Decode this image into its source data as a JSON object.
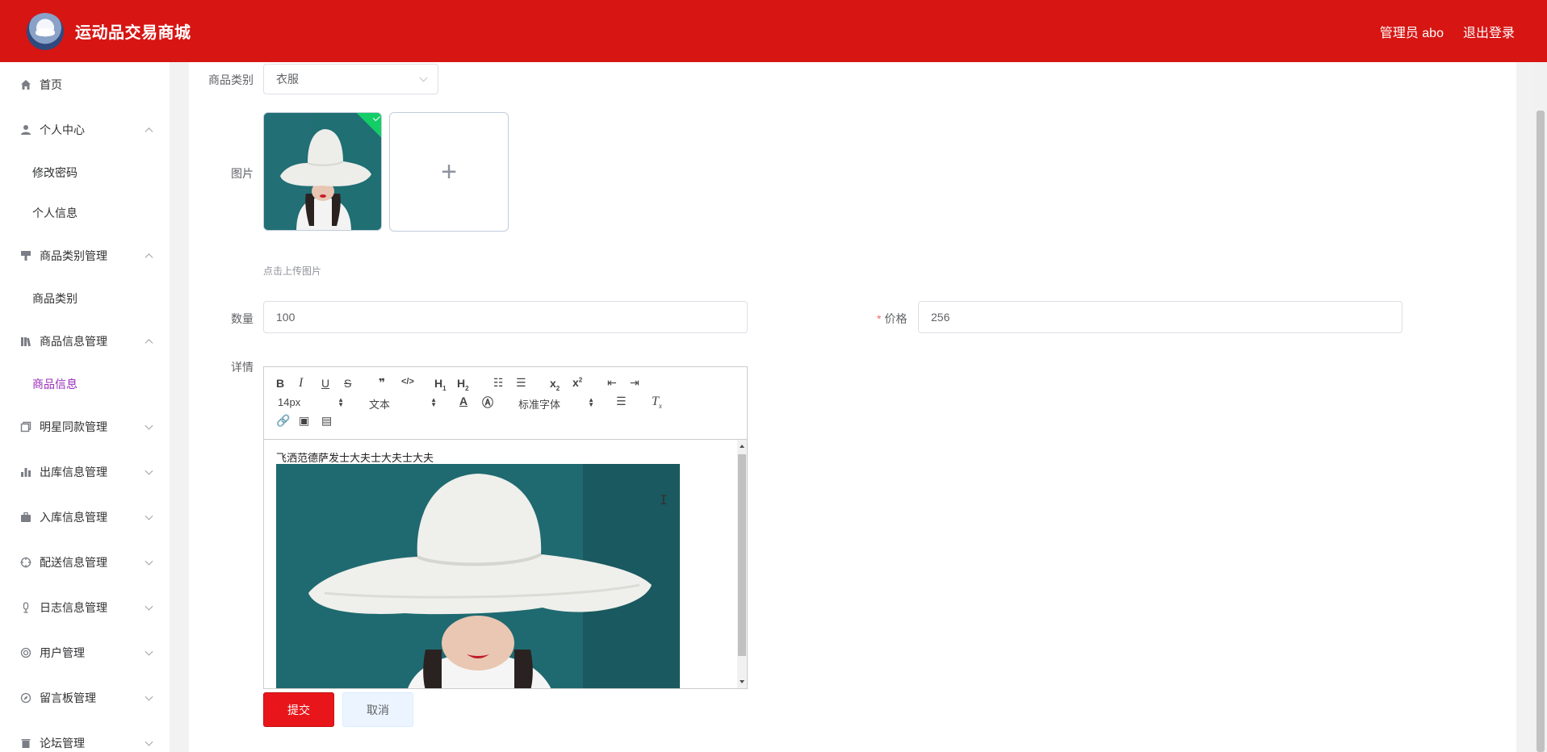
{
  "header": {
    "title": "运动品交易商城",
    "user_label": "管理员 abo",
    "logout_label": "退出登录",
    "bg_color": "#d71513"
  },
  "sidebar": {
    "items": [
      {
        "label": "首页",
        "icon": "home-icon"
      },
      {
        "label": "个人中心",
        "icon": "user-icon",
        "expanded": true,
        "children": [
          "修改密码",
          "个人信息"
        ]
      },
      {
        "label": "商品类别管理",
        "icon": "brush-icon",
        "expanded": true,
        "children": [
          "商品类别"
        ]
      },
      {
        "label": "商品信息管理",
        "icon": "books-icon",
        "expanded": true,
        "children": [
          "商品信息"
        ]
      },
      {
        "label": "明星同款管理",
        "icon": "copy-icon"
      },
      {
        "label": "出库信息管理",
        "icon": "bar-chart-icon"
      },
      {
        "label": "入库信息管理",
        "icon": "suitcase-icon"
      },
      {
        "label": "配送信息管理",
        "icon": "aim-icon"
      },
      {
        "label": "日志信息管理",
        "icon": "mic-icon"
      },
      {
        "label": "用户管理",
        "icon": "life-ring-icon"
      },
      {
        "label": "留言板管理",
        "icon": "compass-icon"
      },
      {
        "label": "论坛管理",
        "icon": "trash-icon"
      }
    ],
    "active_item": "商品信息",
    "active_color": "#9a2bb8"
  },
  "form": {
    "category_label": "商品类别",
    "category_value": "衣服",
    "image_label": "图片",
    "upload_tip": "点击上传图片",
    "quantity_label": "数量",
    "quantity_value": "100",
    "price_label": "价格",
    "price_value": "256",
    "detail_label": "详情",
    "submit_label": "提交",
    "cancel_label": "取消"
  },
  "editor": {
    "font_size": "14px",
    "header_select": "文本",
    "font_family": "标准字体",
    "content_text": "飞洒范德萨发士大夫士大夫士大夫"
  }
}
